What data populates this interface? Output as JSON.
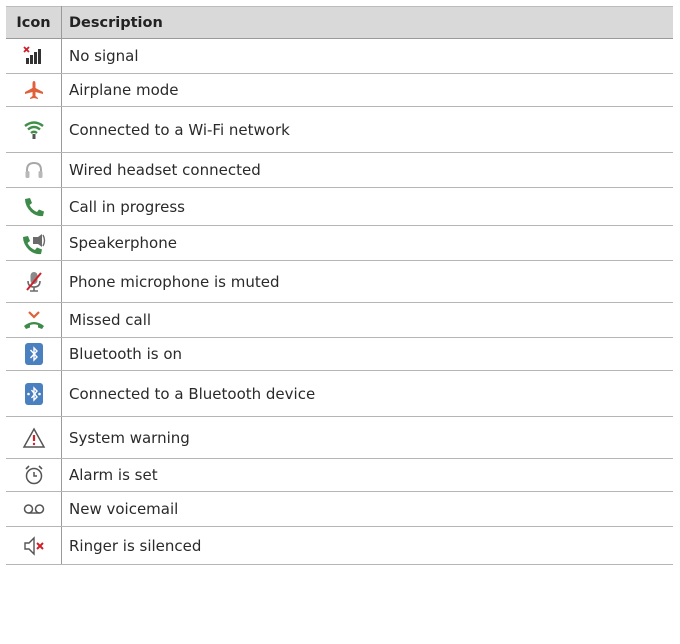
{
  "headers": {
    "icon": "Icon",
    "description": "Description"
  },
  "rows": [
    {
      "icon": "no-signal-icon",
      "description": "No signal"
    },
    {
      "icon": "airplane-mode-icon",
      "description": "Airplane mode"
    },
    {
      "icon": "wifi-connected-icon",
      "description": "Connected to a Wi-Fi network"
    },
    {
      "icon": "headset-icon",
      "description": "Wired headset connected"
    },
    {
      "icon": "call-in-progress-icon",
      "description": "Call in progress"
    },
    {
      "icon": "speakerphone-icon",
      "description": "Speakerphone"
    },
    {
      "icon": "microphone-muted-icon",
      "description": "Phone microphone is muted"
    },
    {
      "icon": "missed-call-icon",
      "description": "Missed call"
    },
    {
      "icon": "bluetooth-on-icon",
      "description": "Bluetooth is on"
    },
    {
      "icon": "bluetooth-connected-icon",
      "description": "Connected to a Bluetooth device"
    },
    {
      "icon": "system-warning-icon",
      "description": "System warning"
    },
    {
      "icon": "alarm-icon",
      "description": "Alarm is set"
    },
    {
      "icon": "voicemail-icon",
      "description": "New voicemail"
    },
    {
      "icon": "ringer-silenced-icon",
      "description": "Ringer is silenced"
    }
  ]
}
